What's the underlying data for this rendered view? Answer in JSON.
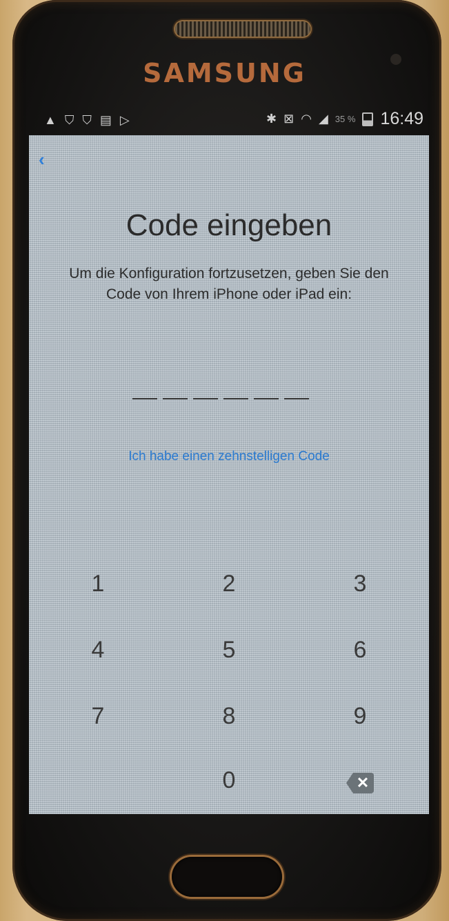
{
  "device": {
    "brand": "SAMSUNG"
  },
  "status_bar": {
    "left_icons": [
      "warning-icon",
      "shield-icon",
      "shield-icon",
      "sim-icon",
      "play-icon"
    ],
    "right_icons": [
      "bluetooth-icon",
      "mute-icon",
      "wifi-icon",
      "signal-icon"
    ],
    "battery": "35 %",
    "time": "16:49"
  },
  "screen": {
    "back_label": "‹",
    "title": "Code eingeben",
    "description": "Um die Konfiguration fortzusetzen, geben Sie den Code von Ihrem iPhone oder iPad ein:",
    "code_length": 6,
    "ten_digit_link": "Ich habe einen zehnstelligen Code",
    "keypad": {
      "k1": "1",
      "k2": "2",
      "k3": "3",
      "k4": "4",
      "k5": "5",
      "k6": "6",
      "k7": "7",
      "k8": "8",
      "k9": "9",
      "k0": "0",
      "delete": "✕"
    }
  },
  "colors": {
    "link": "#2a7ad0",
    "screen_bg": "#b8c4cc",
    "brand": "#b56a3c"
  }
}
